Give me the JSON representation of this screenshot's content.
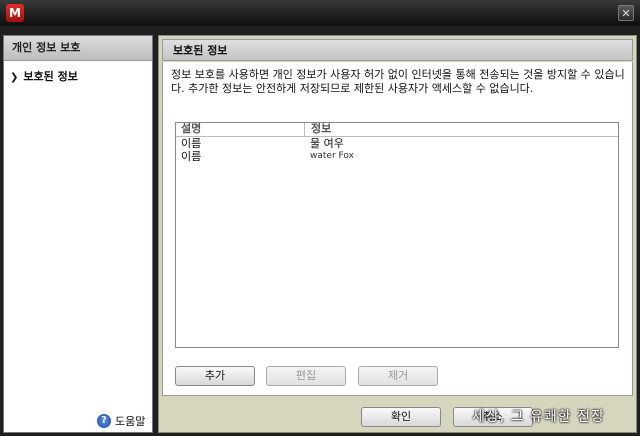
{
  "window": {
    "logo_letter": "M",
    "close_glyph": "✕"
  },
  "sidebar": {
    "header": "개인 정보 보호",
    "items": [
      {
        "label": "보호된 정보"
      }
    ],
    "help_label": "도움말"
  },
  "main": {
    "header": "보호된 정보",
    "description": "정보 보호를 사용하면 개인 정보가 사용자 허가 없이 인터넷을 통해 전송되는 것을 방지할 수 있습니다. 추가한 정보는 안전하게 저장되므로 제한된 사용자가 액세스할 수 없습니다.",
    "table": {
      "columns": [
        "설명",
        "정보"
      ],
      "rows": [
        {
          "description": "이름",
          "info": "물 여우"
        },
        {
          "description": "이름",
          "info": "water Fox"
        }
      ]
    },
    "buttons": {
      "add": "추가",
      "edit": "편집",
      "remove": "제거"
    }
  },
  "footer": {
    "ok": "확인",
    "cancel": "취소"
  },
  "watermark": "세상, 그 유쾌한 전장"
}
